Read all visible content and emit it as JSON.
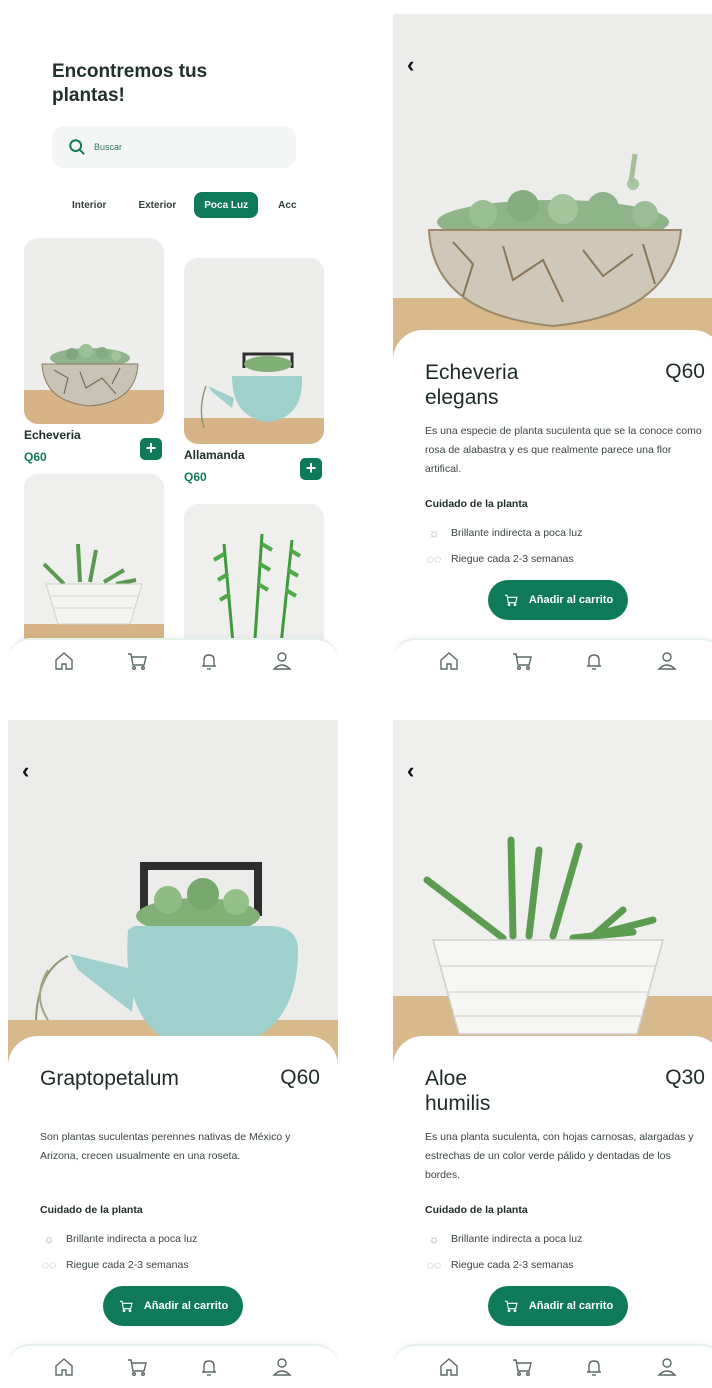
{
  "home": {
    "title": "Encontremos tus plantas!",
    "search_placeholder": "Buscar",
    "tabs": [
      "Interior",
      "Exterior",
      "Poca Luz",
      "Acc"
    ],
    "active_tab": "Poca Luz",
    "products": [
      {
        "name": "Echeveria",
        "price": "Q60"
      },
      {
        "name": "Allamanda",
        "price": "Q60"
      }
    ],
    "add_symbol": "+"
  },
  "details": [
    {
      "name_line1": "Echeveria",
      "name_line2": "elegans",
      "price": "Q60",
      "description": "Es una especie de planta suculenta que se la conoce como rosa de alabastra y es que realmente parece una flor artifical.",
      "care_title": "Cuidado de la planta",
      "care_light": "Brillante indirecta a poca luz",
      "care_water": "Riegue cada 2-3 semanas",
      "button": "Añadir al carrito"
    },
    {
      "name_line1": "Graptopetalum",
      "name_line2": "",
      "price": "Q60",
      "description": "Son plantas suculentas perennes nativas de México y Arizona, crecen usualmente en una roseta.",
      "care_title": "Cuidado de la planta",
      "care_light": "Brillante indirecta a poca luz",
      "care_water": "Riegue cada 2-3 semanas",
      "button": "Añadir al carrito"
    },
    {
      "name_line1": "Aloe",
      "name_line2": "humilis",
      "price": "Q30",
      "description": "Es una planta suculenta, con hojas carnosas, alargadas y estrechas de un color verde pálido y dentadas de los bordes.",
      "care_title": "Cuidado de la planta",
      "care_light": "Brillante indirecta a poca luz",
      "care_water": "Riegue cada 2-3 semanas",
      "button": "Añadir al carrito"
    }
  ],
  "back_symbol": "‹",
  "icons": {
    "light": "sun-icon",
    "water": "water-drops-icon",
    "nav": [
      "home-icon",
      "cart-icon",
      "bell-icon",
      "user-icon"
    ]
  },
  "colors": {
    "accent": "#0f7a59",
    "text": "#1e2b24",
    "shelf": "#d8b98c"
  }
}
